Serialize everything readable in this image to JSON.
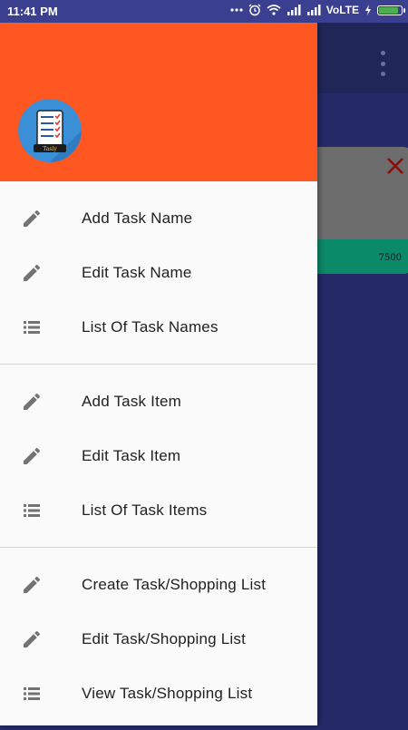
{
  "status_bar": {
    "time": "11:41 PM",
    "network_label": "VoLTE",
    "icons": [
      "dots-icon",
      "alarm-icon",
      "wifi-icon",
      "signal-icon",
      "signal-icon",
      "charging-icon",
      "battery-icon"
    ],
    "battery_level": 0.9,
    "battery_color": "#4caf50"
  },
  "background_app": {
    "toolbar_color": "#212659",
    "card": {
      "amount": "7500"
    }
  },
  "drawer": {
    "header_color": "#ff5722",
    "logo": {
      "icon": "checklist-icon",
      "text": "Tasly"
    },
    "sections": [
      {
        "items": [
          {
            "icon": "pencil-icon",
            "label": "Add Task Name"
          },
          {
            "icon": "pencil-icon",
            "label": "Edit Task Name"
          },
          {
            "icon": "list-icon",
            "label": "List Of Task Names"
          }
        ]
      },
      {
        "items": [
          {
            "icon": "pencil-icon",
            "label": "Add Task Item"
          },
          {
            "icon": "pencil-icon",
            "label": "Edit Task Item"
          },
          {
            "icon": "list-icon",
            "label": "List Of Task Items"
          }
        ]
      },
      {
        "items": [
          {
            "icon": "pencil-icon",
            "label": "Create Task/Shopping List"
          },
          {
            "icon": "pencil-icon",
            "label": "Edit Task/Shopping List"
          },
          {
            "icon": "list-icon",
            "label": "View Task/Shopping List"
          }
        ]
      }
    ]
  }
}
